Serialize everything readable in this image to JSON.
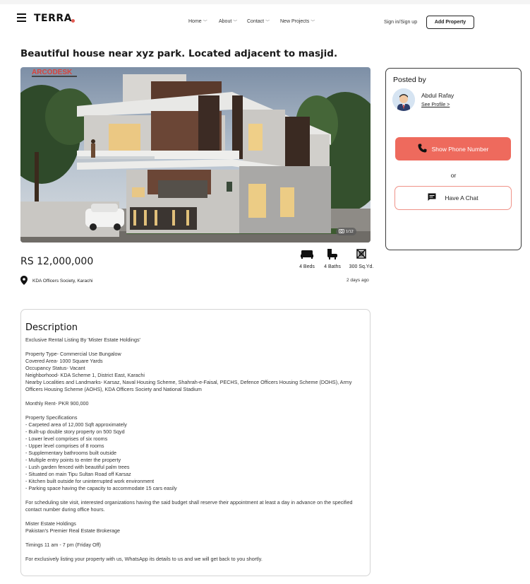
{
  "nav": {
    "logo": "TERRA",
    "links": [
      {
        "label": "Home"
      },
      {
        "label": "About"
      },
      {
        "label": "Contact"
      },
      {
        "label": "New Projects"
      }
    ],
    "signin": "Sign in/Sign up",
    "add_property": "Add Property"
  },
  "listing": {
    "title": "Beautiful house near xyz park. Located adjacent to masjid.",
    "watermark": "ARCODESK",
    "photo_count": "1/12",
    "price": "RS 12,000,000",
    "location": "KDA Officers Society, Karachi",
    "posted_ago": "2 days ago",
    "features": {
      "beds": "4 Beds",
      "baths": "4 Baths",
      "area": "300 Sq.Yd."
    }
  },
  "agent": {
    "posted_by": "Posted by",
    "name": "Abdul Rafay",
    "see_profile": "See Profile >",
    "show_phone": "Show Phone Number",
    "or": "or",
    "chat": "Have A Chat"
  },
  "description": {
    "heading": "Description",
    "body": "Exclusive Rental Listing By 'Mister Estate Holdings'\n\nProperty Type- Commercial Use Bungalow\nCovered Area- 1000 Square Yards\nOccupancy Status- Vacant\nNeighborhood- KDA Scheme 1, District East, Karachi\nNearby Localities and Landmarks- Karsaz, Naval Housing Scheme, Shahrah-e-Faisal, PECHS, Defence Officers Housing Scheme (DOHS), Army Officers Housing Scheme (AOHS), KDA Officers Society and National Stadium\n\nMonthly Rent- PKR 900,000\n\nProperty Specifications\n- Carpeted area of 12,000 Sqft approximately\n- Built-up double story property on 500 Sqyd\n- Lower level comprises of six rooms\n- Upper level comprises of 8 rooms\n- Supplementary bathrooms built outside\n- Multiple entry points to enter the property\n- Lush garden fenced with beautiful palm trees\n- Situated on main Tipu Sultan Road off Karsaz\n- Kitchen built outside for uninterrupted work environment\n- Parking space having the capacity to accommodate 15 cars easily\n\nFor scheduling site visit, interested organizations having the said budget shall reserve their appointment at least a day in advance on the specified contact number during office hours.\n\nMister Estate Holdings\nPakistan's Premier Real Estate Brokerage\n\nTimings 11 am - 7 pm (Friday Off)\n\nFor exclusively listing your property with us, WhatsApp its details to us and we will get back to you shortly."
  },
  "colors": {
    "accent": "#ee6a5d",
    "chat_border": "#ef9288",
    "logo_dot": "#e35d55"
  }
}
